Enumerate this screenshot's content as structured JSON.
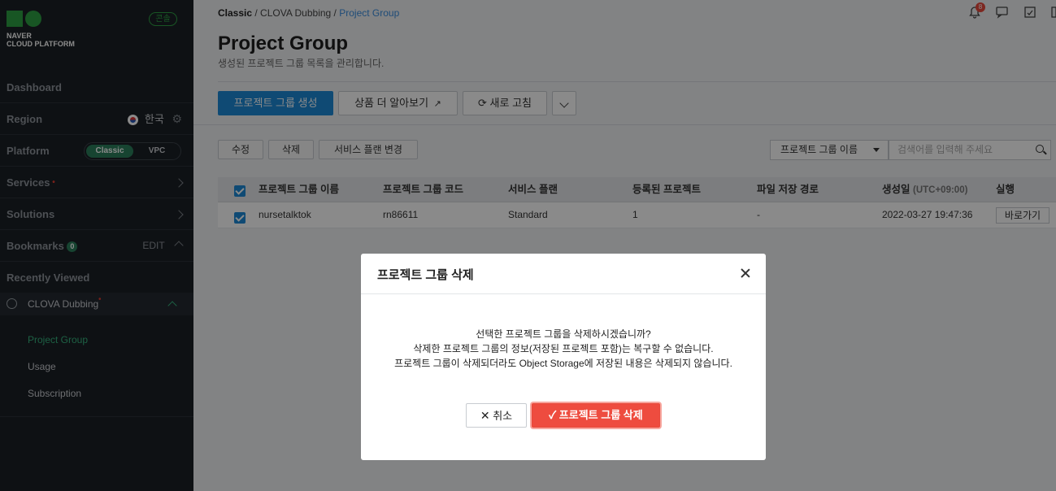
{
  "sidebar": {
    "logo_line1": "NAVER",
    "logo_line2": "CLOUD PLATFORM",
    "console_badge": "콘솔",
    "dashboard": "Dashboard",
    "region_label": "Region",
    "region_value": "한국",
    "platform_label": "Platform",
    "platform_options": [
      "Classic",
      "VPC"
    ],
    "platform_selected": "Classic",
    "services": "Services",
    "solutions": "Solutions",
    "bookmarks": "Bookmarks",
    "bookmarks_count": "0",
    "edit": "EDIT",
    "recently_viewed": "Recently Viewed",
    "recent_item": "CLOVA Dubbing",
    "sub_items": [
      "Project Group",
      "Usage",
      "Subscription"
    ],
    "active_sub_item": "Project Group"
  },
  "header": {
    "breadcrumb": [
      "Classic",
      "CLOVA Dubbing",
      "Project Group"
    ],
    "notification_count": "8",
    "title": "Project Group",
    "subtitle": "생성된 프로젝트 그룹 목록을 관리합니다."
  },
  "toolbar": {
    "create_label": "프로젝트 그룹 생성",
    "learn_more_label": "상품 더 알아보기",
    "refresh_label": "새로 고침"
  },
  "actions": {
    "edit_label": "수정",
    "delete_label": "삭제",
    "change_plan_label": "서비스 플랜 변경"
  },
  "search": {
    "select_value": "프로젝트 그룹 이름",
    "placeholder": "검색어를 입력해 주세요"
  },
  "table": {
    "columns": [
      "프로젝트 그룹 이름",
      "프로젝트 그룹 코드",
      "서비스 플랜",
      "등록된 프로젝트",
      "파일 저장 경로",
      "생성일",
      "실행"
    ],
    "created_tz": "(UTC+09:00)",
    "rows": [
      {
        "name": "nursetalktok",
        "code": "rn86611",
        "plan": "Standard",
        "projects": "1",
        "path": "-",
        "created": "2022-03-27 19:47:36",
        "action": "바로가기"
      }
    ]
  },
  "modal": {
    "title": "프로젝트 그룹 삭제",
    "line1": "선택한 프로젝트 그룹을 삭제하시겠습니까?",
    "line2": "삭제한 프로젝트 그룹의 정보(저장된 프로젝트 포함)는 복구할 수 없습니다.",
    "line3": "프로젝트 그룹이 삭제되더라도 Object Storage에 저장된 내용은 삭제되지 않습니다.",
    "cancel_label": "취소",
    "confirm_label": "프로젝트 그룹 삭제"
  },
  "colors": {
    "primary": "#1d8ad6",
    "danger": "#ee4c3f",
    "sidebar_bg": "#1b2026",
    "brand_green": "#2ea043"
  }
}
